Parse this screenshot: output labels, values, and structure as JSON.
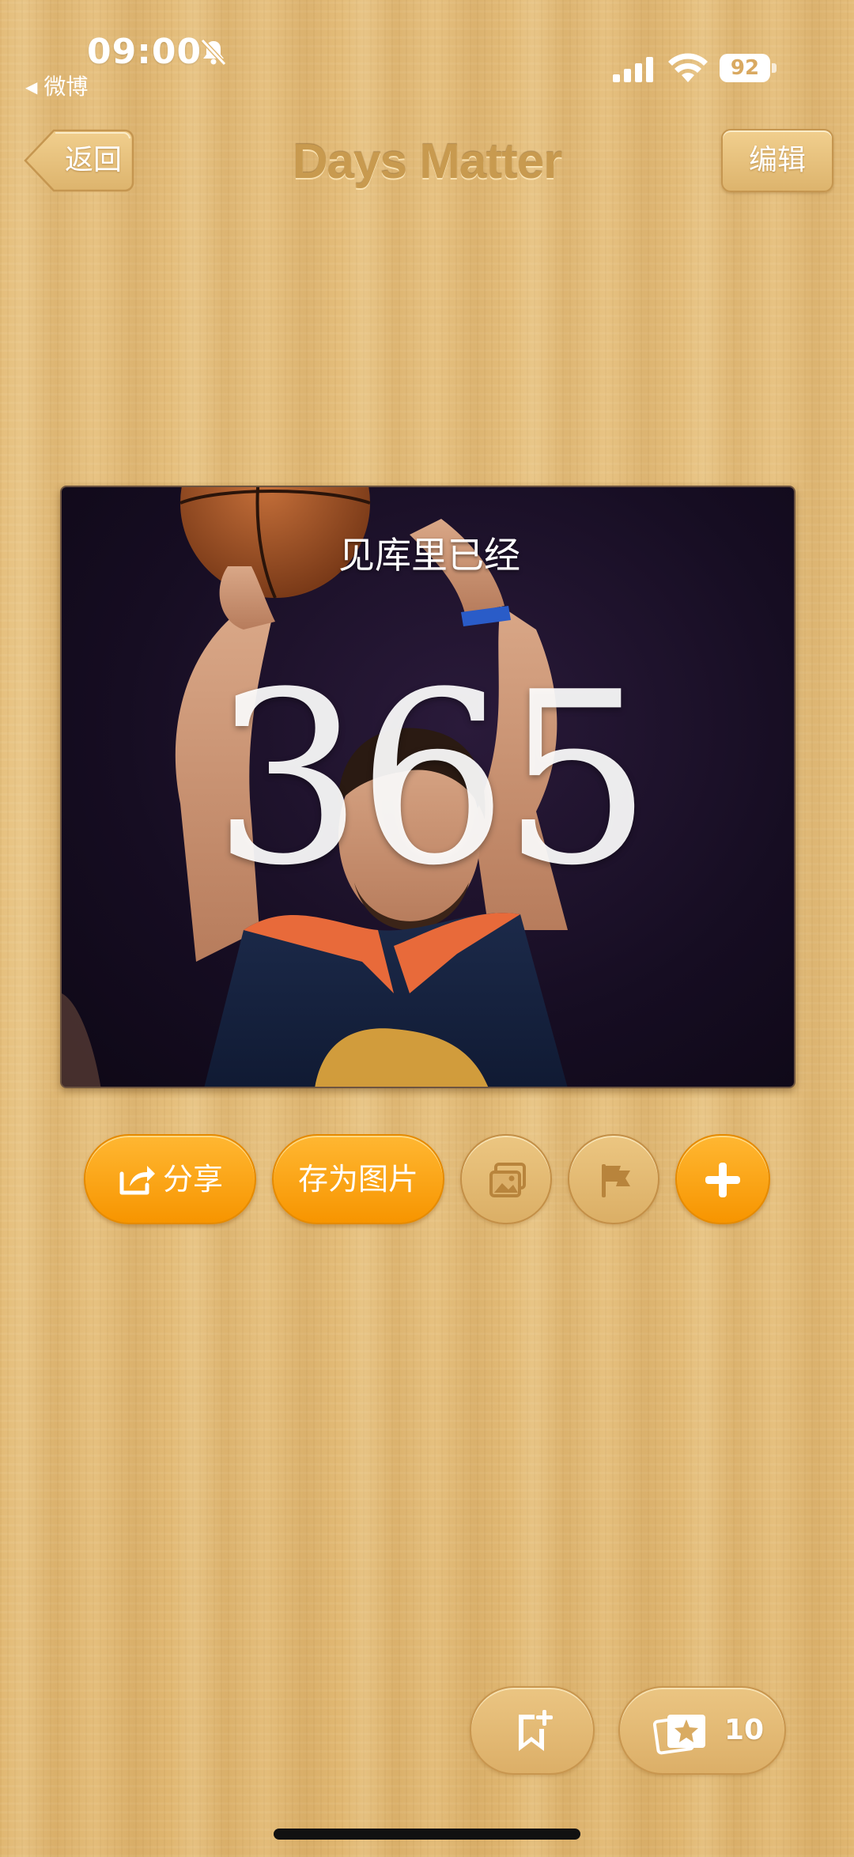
{
  "status_bar": {
    "time": "09:00",
    "back_app": "微博",
    "battery": "92",
    "icons": [
      "mute-icon",
      "signal-icon",
      "wifi-icon",
      "battery-icon"
    ]
  },
  "nav": {
    "back_label": "返回",
    "title": "Days Matter",
    "edit_label": "编辑"
  },
  "card": {
    "caption": "见库里已经",
    "number": "365",
    "background": "photo-basketball-player"
  },
  "actions": {
    "share_label": "分享",
    "save_label": "存为图片",
    "share_icon": "share-icon",
    "photo_icon": "photo-icon",
    "flag_icon": "flag-icon",
    "add_icon": "plus-icon"
  },
  "toolbar": {
    "bookmark_icon": "bookmark-add-icon",
    "gallery_icon": "gallery-star-icon",
    "gallery_count": "10"
  },
  "colors": {
    "accent_orange": "#f9a012",
    "wood": "#e2b873",
    "title": "#c89a4f"
  }
}
